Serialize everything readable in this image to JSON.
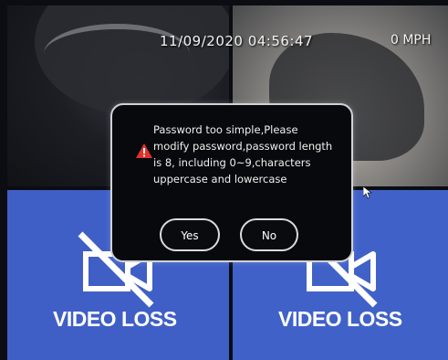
{
  "overlay": {
    "timestamp": "11/09/2020 04:56:47",
    "speed": "0 MPH"
  },
  "channels": [
    {
      "status": "live"
    },
    {
      "status": "live"
    },
    {
      "status": "video-loss",
      "label": "VIDEO LOSS"
    },
    {
      "status": "video-loss",
      "label": "VIDEO LOSS"
    }
  ],
  "dialog": {
    "icon": "warning-icon",
    "message_lines": [
      "Password too simple,Please",
      "modify password,password length",
      "is 8, including 0~9,characters",
      "uppercase and lowercase"
    ],
    "yes_label": "Yes",
    "no_label": "No"
  },
  "colors": {
    "video_loss_bg": "#3f5fc6",
    "warning": "#e0332b",
    "dialog_bg": "#08090c"
  }
}
